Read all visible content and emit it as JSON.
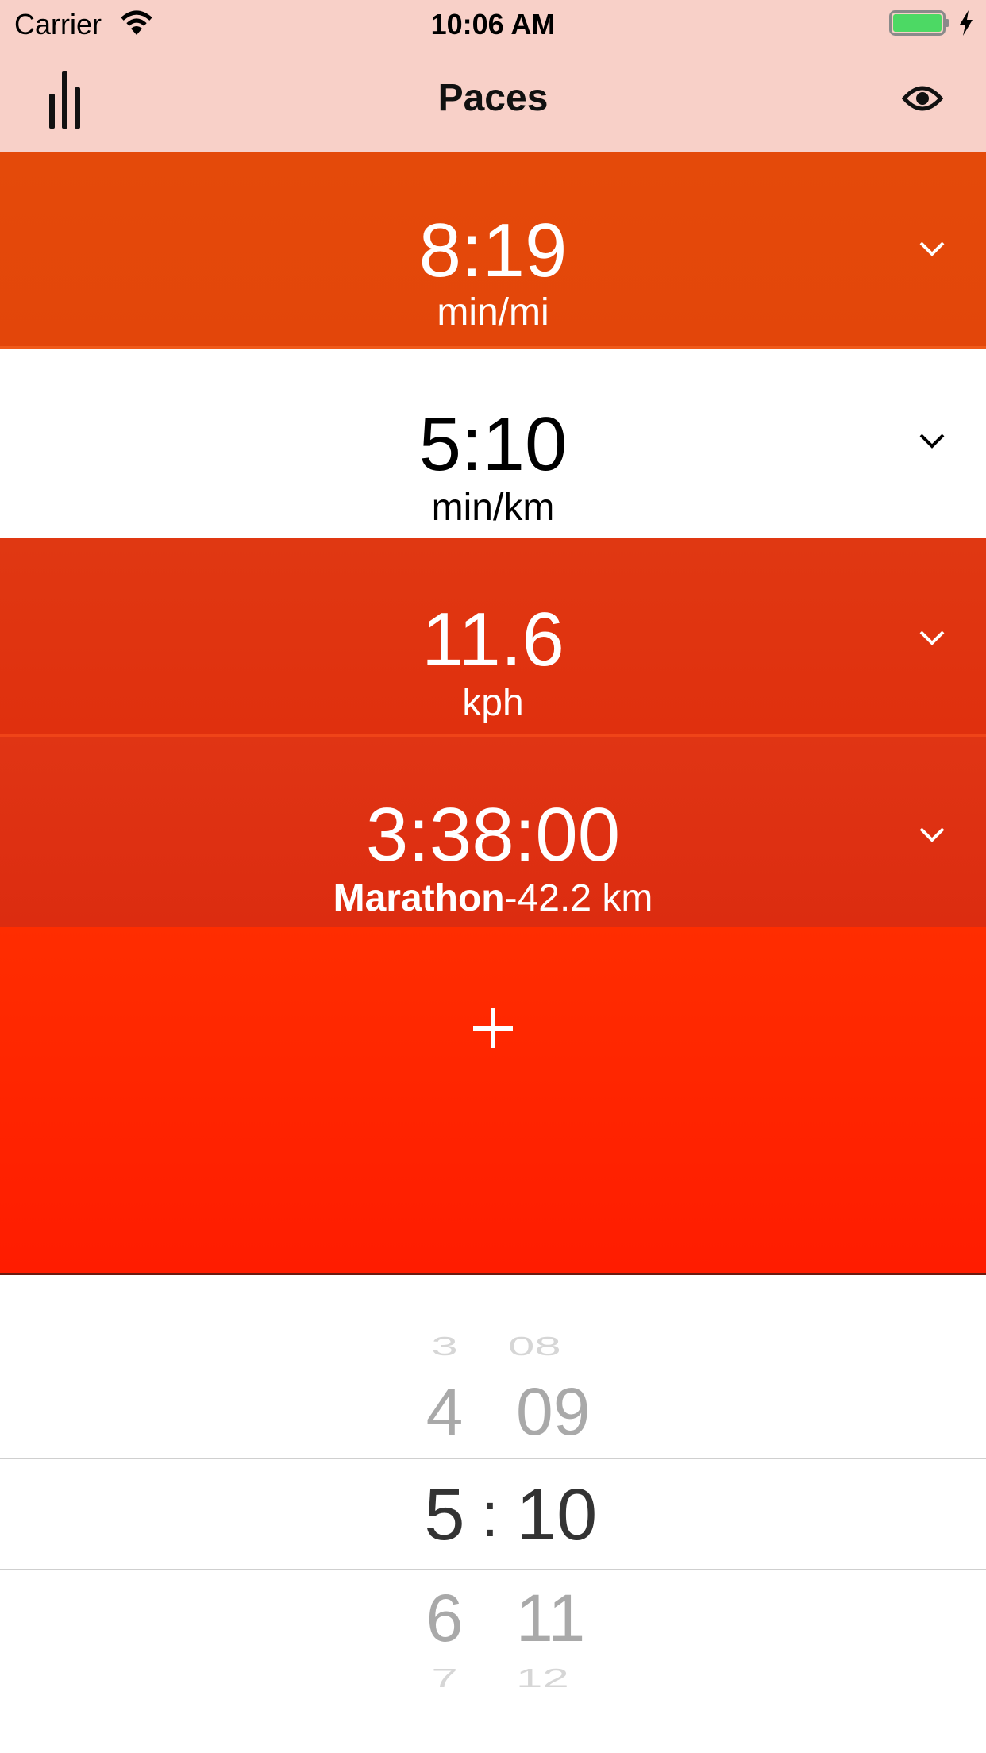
{
  "status_bar": {
    "carrier": "Carrier",
    "time": "10:06 AM"
  },
  "nav": {
    "title": "Paces",
    "left_icon": "bar-chart-icon",
    "right_icon": "eye-icon"
  },
  "rows": [
    {
      "value": "8:19",
      "unit": "min/mi"
    },
    {
      "value": "5:10",
      "unit": "min/km"
    },
    {
      "value": "11.6",
      "unit": "kph"
    },
    {
      "value": "3:38:00",
      "unit_bold": "Marathon",
      "unit_rest": "-42.2 km"
    }
  ],
  "add_button": {
    "label": "+"
  },
  "picker": {
    "separator": ":",
    "left_column": [
      "3",
      "4",
      "5",
      "6",
      "7"
    ],
    "right_column": [
      "08",
      "09",
      "10",
      "11",
      "12"
    ],
    "selected_index": 2
  },
  "colors": {
    "nav_bg": "#f8d0c8",
    "row_orange": "#e44a0a",
    "row_red": "#e0300e",
    "add_red": "#ff2200"
  }
}
